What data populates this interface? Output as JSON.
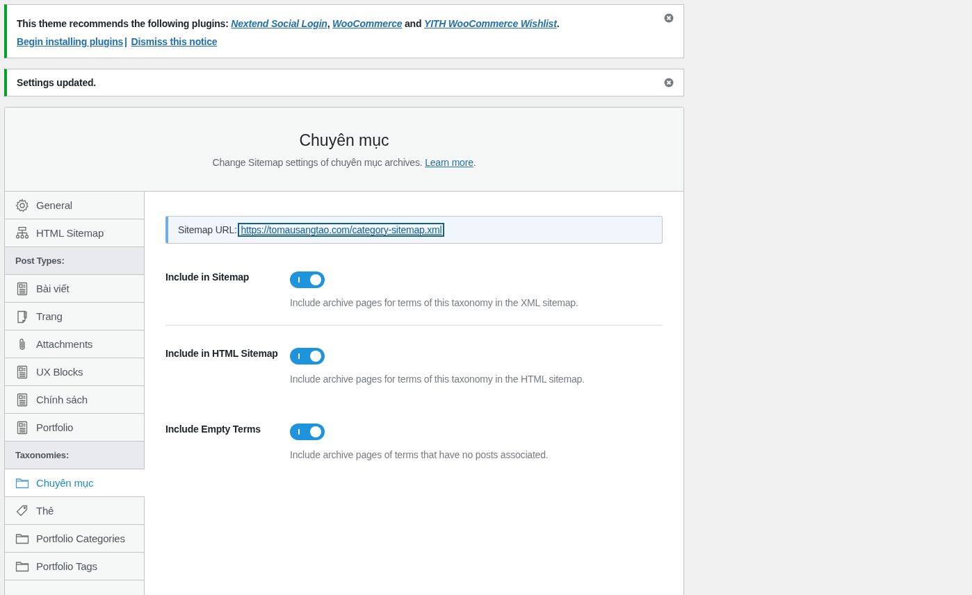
{
  "notices": [
    {
      "segments": [
        {
          "kind": "text",
          "text": "This theme recommends the following plugins: "
        },
        {
          "kind": "link",
          "text": "Nextend Social Login"
        },
        {
          "kind": "text",
          "text": ", "
        },
        {
          "kind": "link",
          "text": "WooCommerce"
        },
        {
          "kind": "text",
          "text": " and "
        },
        {
          "kind": "link",
          "text": "YITH WooCommerce Wishlist"
        },
        {
          "kind": "text",
          "text": "."
        }
      ],
      "actions": [
        "Begin installing plugins",
        "Dismiss this notice"
      ],
      "separator": "|"
    },
    {
      "segments": [
        {
          "kind": "text",
          "text": "Settings updated."
        }
      ]
    }
  ],
  "header": {
    "title": "Chuyên mục",
    "description": "Change Sitemap settings of chuyên mục archives.",
    "link": "Learn more",
    "after_link": "."
  },
  "sidebar": [
    {
      "kind": "settings",
      "label": "General",
      "selected": false
    },
    {
      "kind": "sitemap",
      "label": "HTML Sitemap",
      "selected": false
    },
    {
      "kind": "heading",
      "label": "Post Types:"
    },
    {
      "kind": "post",
      "label": "Bài viết",
      "selected": false
    },
    {
      "kind": "page",
      "label": "Trang",
      "selected": false
    },
    {
      "kind": "attachment",
      "label": "Attachments",
      "selected": false
    },
    {
      "kind": "post",
      "label": "UX Blocks",
      "selected": false
    },
    {
      "kind": "post",
      "label": "Chính sách",
      "selected": false
    },
    {
      "kind": "post",
      "label": "Portfolio",
      "selected": false
    },
    {
      "kind": "heading",
      "label": "Taxonomies:"
    },
    {
      "kind": "folder",
      "label": "Chuyên mục",
      "selected": true
    },
    {
      "kind": "tag",
      "label": "Thẻ",
      "selected": false
    },
    {
      "kind": "folder",
      "label": "Portfolio Categories",
      "selected": false
    },
    {
      "kind": "folder",
      "label": "Portfolio Tags",
      "selected": false
    }
  ],
  "sitemap_url": {
    "label": "Sitemap URL:",
    "url": "https://tomausangtao.com/category-sitemap.xml"
  },
  "settings": [
    {
      "label": "Include in Sitemap",
      "on": true,
      "description": "Include archive pages for terms of this taxonomy in the XML sitemap."
    },
    {
      "label": "Include in HTML Sitemap",
      "on": true,
      "description": "Include archive pages for terms of this taxonomy in the HTML sitemap."
    },
    {
      "label": "Include Empty Terms",
      "on": true,
      "description": "Include archive pages of terms that have no posts associated."
    }
  ]
}
